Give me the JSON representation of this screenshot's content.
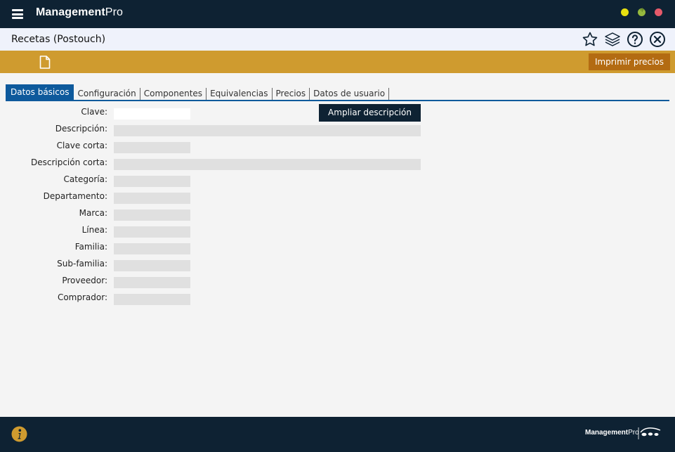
{
  "app": {
    "brand_bold": "Management",
    "brand_light": "Pro",
    "window_buttons": [
      "minimize",
      "maximize",
      "close"
    ],
    "colors": {
      "titlebar": "#0e2233",
      "toolbar": "#cf9b2f",
      "accent": "#0e5a9c",
      "print_button": "#b36b12"
    }
  },
  "header": {
    "title": "Recetas (Postouch)",
    "icons": [
      "star-icon",
      "layers-icon",
      "help-icon",
      "close-circle-icon"
    ]
  },
  "toolbar": {
    "new_icon": "new-document-icon",
    "print_label": "Imprimir precios"
  },
  "tabs": [
    {
      "label": "Datos básicos",
      "active": true
    },
    {
      "label": "Configuración",
      "active": false
    },
    {
      "label": "Componentes",
      "active": false
    },
    {
      "label": "Equivalencias",
      "active": false
    },
    {
      "label": "Precios",
      "active": false
    },
    {
      "label": "Datos de usuario",
      "active": false
    }
  ],
  "form": {
    "ampliar_label": "Ampliar descripción",
    "fields": [
      {
        "label": "Clave:",
        "value": ""
      },
      {
        "label": "Descripción:",
        "value": ""
      },
      {
        "label": "Clave corta:",
        "value": ""
      },
      {
        "label": "Descripción corta:",
        "value": ""
      },
      {
        "label": "Categoría:",
        "value": ""
      },
      {
        "label": "Departamento:",
        "value": ""
      },
      {
        "label": "Marca:",
        "value": ""
      },
      {
        "label": "Línea:",
        "value": ""
      },
      {
        "label": "Familia:",
        "value": ""
      },
      {
        "label": "Sub-familia:",
        "value": ""
      },
      {
        "label": "Proveedor:",
        "value": ""
      },
      {
        "label": "Comprador:",
        "value": ""
      }
    ]
  },
  "footer": {
    "info_icon": "info-icon",
    "brand_bold": "Management",
    "brand_light": "Pro"
  }
}
